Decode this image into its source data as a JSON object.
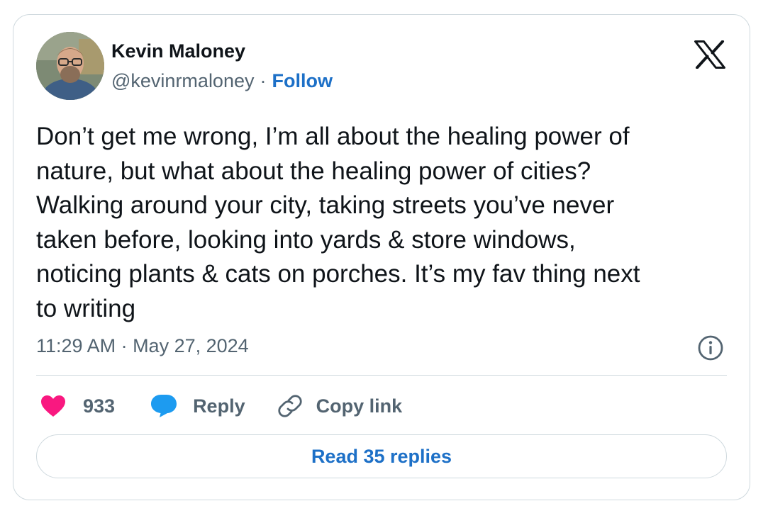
{
  "author": {
    "name": "Kevin Maloney",
    "handle": "@kevinrmaloney",
    "separator": "·",
    "follow_label": "Follow"
  },
  "tweet": {
    "text": "Don’t get me wrong, I’m all about the healing power of\nnature, but what about the healing power of cities?\nWalking around your city, taking streets you’ve never\ntaken before, looking into yards & store windows,\nnoticing plants & cats on porches. It’s my fav thing next\nto writing",
    "timestamp": "11:29 AM · May 27, 2024"
  },
  "actions": {
    "like_count": "933",
    "reply_label": "Reply",
    "copy_link_label": "Copy link"
  },
  "read_replies_label": "Read 35 replies",
  "icons": {
    "brand": "x-logo-icon",
    "info": "info-icon",
    "like": "heart-icon",
    "reply": "speech-bubble-icon",
    "copy": "link-icon"
  },
  "colors": {
    "accent": "#1d70c7",
    "heart": "#f91880",
    "reply_bubble": "#1d9bf0",
    "muted": "#536471",
    "text": "#0f1419",
    "border": "#cfd9de"
  }
}
